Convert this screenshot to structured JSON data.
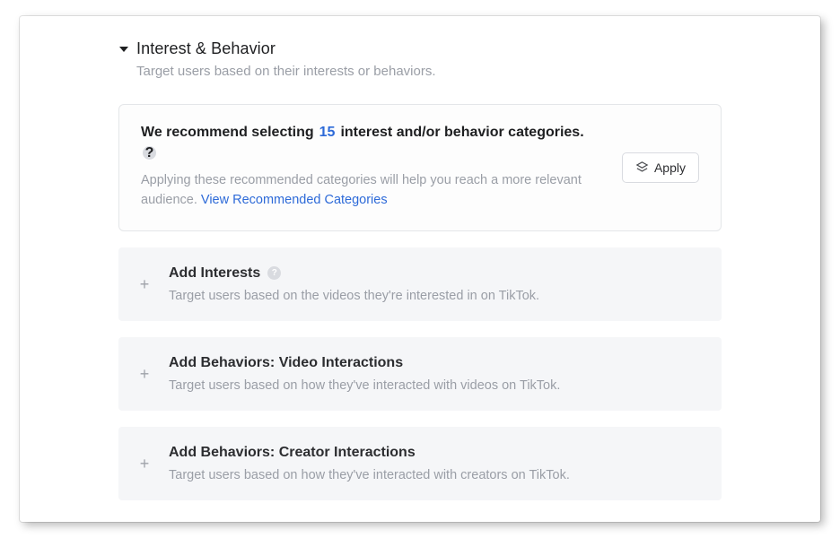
{
  "section": {
    "title": "Interest & Behavior",
    "subtitle": "Target users based on their interests or behaviors."
  },
  "reco": {
    "prefix": "We recommend selecting",
    "count": "15",
    "suffix": "interest and/or behavior categories.",
    "info_glyph": "?",
    "body": "Applying these recommended categories will help you reach a more relevant audience.",
    "link": "View Recommended Categories",
    "apply_label": "Apply"
  },
  "cards": {
    "interests": {
      "title": "Add Interests",
      "sub": "Target users based on the videos they're interested in on TikTok.",
      "info_glyph": "?"
    },
    "video": {
      "title": "Add Behaviors: Video Interactions",
      "sub": "Target users based on how they've interacted with videos on TikTok."
    },
    "creator": {
      "title": "Add Behaviors: Creator Interactions",
      "sub": "Target users based on how they've interacted with creators on TikTok."
    }
  },
  "glyphs": {
    "plus": "+"
  }
}
